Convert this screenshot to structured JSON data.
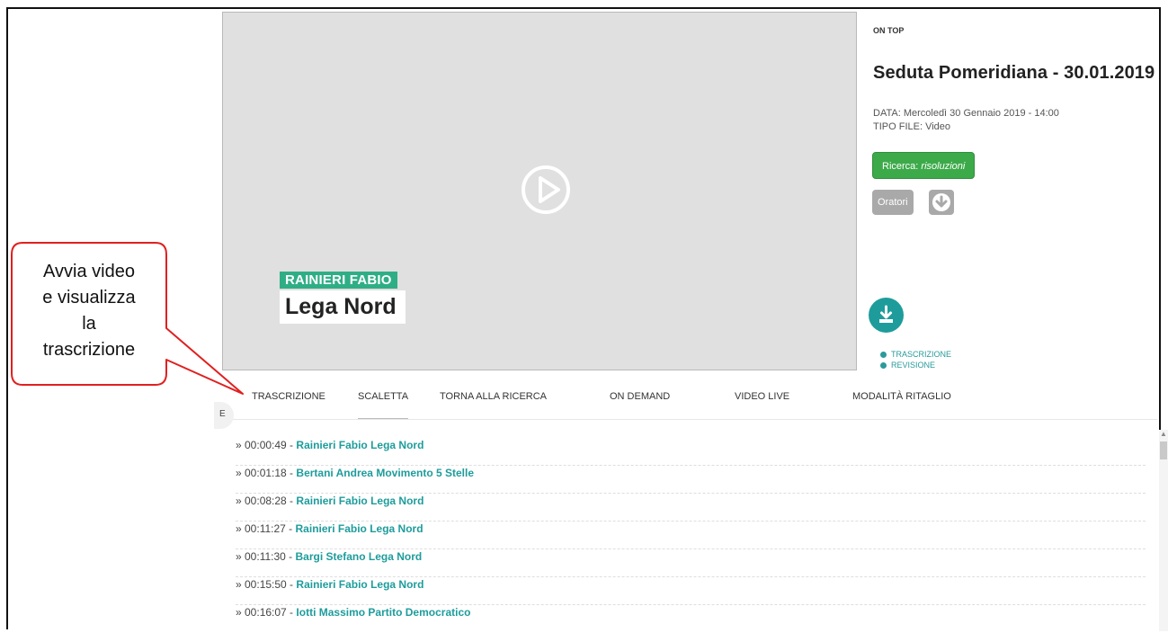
{
  "video": {
    "lower_third_name": "RAINIERI FABIO",
    "lower_third_party": "Lega Nord"
  },
  "info": {
    "badge": "ON TOP",
    "title": "Seduta Pomeridiana - 30.01.2019",
    "data_line": "DATA: Mercoledì 30 Gennaio 2019 - 14:00",
    "tipo_line": "TIPO FILE: Video",
    "ricerca_label": "Ricerca:",
    "ricerca_value": "risoluzioni",
    "oratori_label": "Oratori",
    "legend": [
      "TRASCRIZIONE",
      "REVISIONE"
    ]
  },
  "tabs": [
    "TRASCRIZIONE",
    "SCALETTA",
    "TORNA ALLA RICERCA",
    "ON DEMAND",
    "VIDEO LIVE",
    "MODALITÀ RITAGLIO"
  ],
  "side_handle": "E",
  "list": [
    {
      "time": "» 00:00:49 -",
      "speaker": "Rainieri Fabio Lega Nord"
    },
    {
      "time": "» 00:01:18 -",
      "speaker": "Bertani Andrea Movimento 5 Stelle"
    },
    {
      "time": "» 00:08:28 -",
      "speaker": "Rainieri Fabio Lega Nord"
    },
    {
      "time": "» 00:11:27 -",
      "speaker": "Rainieri Fabio Lega Nord"
    },
    {
      "time": "» 00:11:30 -",
      "speaker": "Bargi Stefano Lega Nord"
    },
    {
      "time": "» 00:15:50 -",
      "speaker": "Rainieri Fabio Lega Nord"
    },
    {
      "time": "» 00:16:07 -",
      "speaker": "Iotti Massimo Partito Democratico"
    }
  ],
  "callout": {
    "lines": [
      "Avvia video",
      "e visualizza",
      "la",
      "trascrizione"
    ]
  },
  "colors": {
    "accent": "#1e9c9c",
    "ricerca": "#3daa4a",
    "callout_border": "#e02020"
  }
}
